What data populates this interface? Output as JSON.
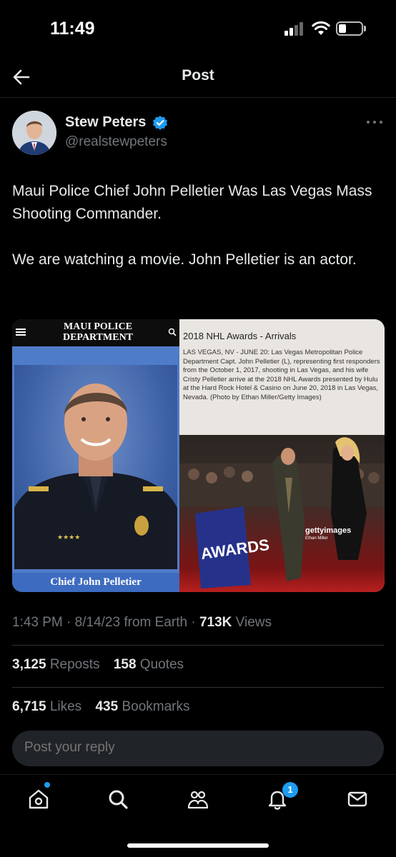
{
  "status_bar": {
    "time": "11:49"
  },
  "header": {
    "title": "Post",
    "back_icon": "arrow-left-icon"
  },
  "author": {
    "name": "Stew Peters",
    "handle": "@realstewpeters",
    "verified": true
  },
  "tweet": {
    "paragraphs": [
      "Maui Police Chief John Pelletier Was Las Vegas Mass Shooting Commander.",
      "We are watching a movie. John Pelletier is an actor."
    ]
  },
  "media": {
    "left": {
      "header_title": "MAUI POLICE DEPARTMENT",
      "caption": "Chief John Pelletier"
    },
    "right": {
      "title": "2018 NHL Awards - Arrivals",
      "description": "LAS VEGAS, NV - JUNE 20: Las Vegas Metropolitan Police Department Capt. John Pelletier (L), representing first responders from the October 1, 2017, shooting in Las Vegas, and his wife Cristy Pelletier arrive at the 2018 NHL Awards presented by Hulu at the Hard Rock Hotel & Casino on June 20, 2018 in Las Vegas, Nevada. (Photo by Ethan Miller/Getty Images)",
      "watermark": "gettyimages",
      "watermark_credit": "Ethan Miller",
      "sign_text": "AWARDS"
    }
  },
  "meta": {
    "time": "1:43 PM",
    "date": "8/14/23",
    "source": "from Earth",
    "views_count": "713K",
    "views_label": "Views"
  },
  "stats": {
    "reposts_count": "3,125",
    "reposts_label": "Reposts",
    "quotes_count": "158",
    "quotes_label": "Quotes",
    "likes_count": "6,715",
    "likes_label": "Likes",
    "bookmarks_count": "435",
    "bookmarks_label": "Bookmarks"
  },
  "reply": {
    "placeholder": "Post your reply"
  },
  "bottom_nav": {
    "items": [
      "home-icon",
      "search-icon",
      "communities-icon",
      "notifications-icon",
      "messages-icon"
    ],
    "notification_count": "1"
  },
  "colors": {
    "accent": "#1d9bf0",
    "background": "#000000",
    "muted_text": "#71767b"
  }
}
